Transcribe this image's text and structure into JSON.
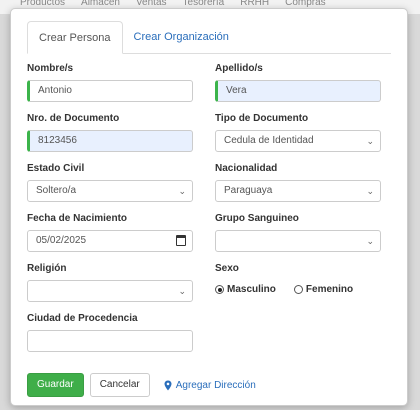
{
  "background_nav": [
    "Productos",
    "Almacen",
    "Ventas",
    "Tesorería",
    "RRHH",
    "Compras"
  ],
  "tabs": [
    {
      "label": "Crear Persona",
      "active": true
    },
    {
      "label": "Crear Organización",
      "active": false
    }
  ],
  "form": {
    "nombres": {
      "label": "Nombre/s",
      "value": "Antonio"
    },
    "apellidos": {
      "label": "Apellido/s",
      "value": "Vera"
    },
    "nro_documento": {
      "label": "Nro. de Documento",
      "value": "8123456"
    },
    "tipo_documento": {
      "label": "Tipo de Documento",
      "value": "Cedula de Identidad"
    },
    "estado_civil": {
      "label": "Estado Civil",
      "value": "Soltero/a"
    },
    "nacionalidad": {
      "label": "Nacionalidad",
      "value": "Paraguaya"
    },
    "fecha_nacimiento": {
      "label": "Fecha de Nacimiento",
      "value": "05/02/2025"
    },
    "grupo_sanguineo": {
      "label": "Grupo Sanguineo",
      "value": ""
    },
    "religion": {
      "label": "Religión",
      "value": ""
    },
    "sexo": {
      "label": "Sexo",
      "options": [
        {
          "label": "Masculino",
          "checked": true
        },
        {
          "label": "Femenino",
          "checked": false
        }
      ]
    },
    "ciudad_procedencia": {
      "label": "Ciudad de Procedencia",
      "value": ""
    }
  },
  "footer": {
    "save_label": "Guardar",
    "cancel_label": "Cancelar",
    "add_address_label": "Agregar Dirección"
  },
  "colors": {
    "primary": "#3fae49",
    "link": "#2a6ebb",
    "valid_border": "#3cb44b",
    "autofill_bg": "#e8f0fe"
  }
}
